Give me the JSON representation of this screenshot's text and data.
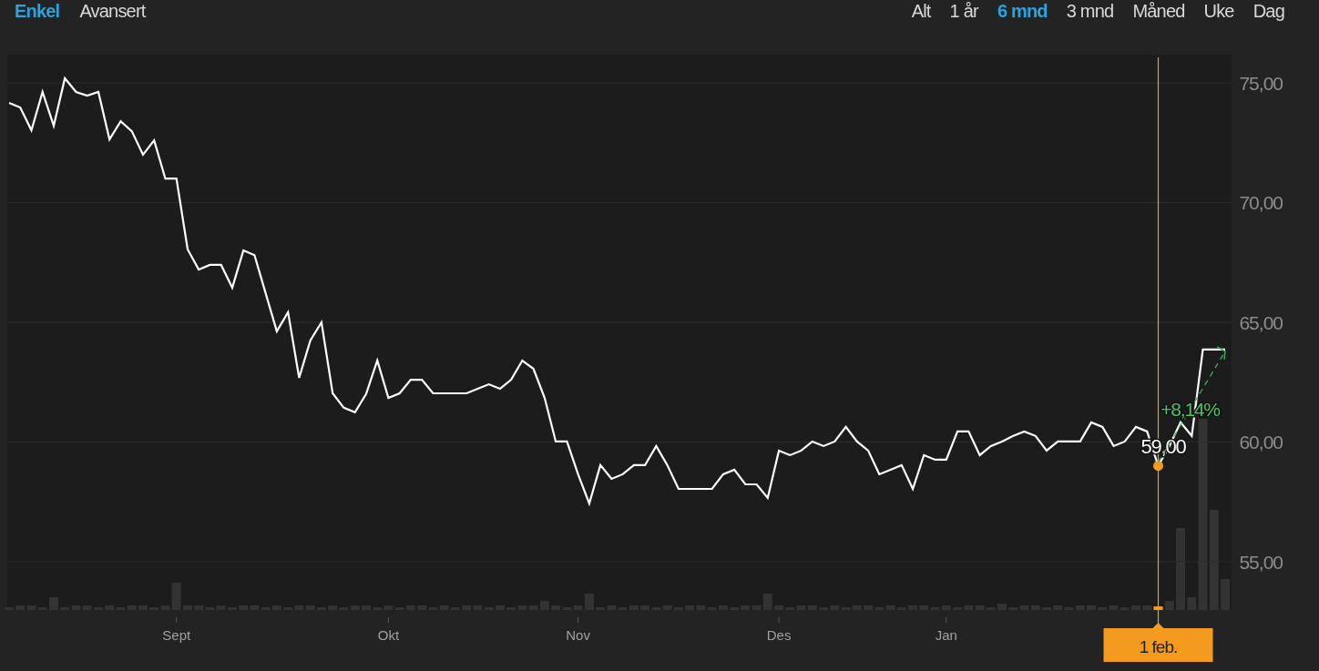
{
  "view_tabs": [
    {
      "label": "Enkel",
      "selected": true
    },
    {
      "label": "Avansert",
      "selected": false
    }
  ],
  "range_tabs": [
    {
      "label": "Alt",
      "selected": false
    },
    {
      "label": "1 år",
      "selected": false
    },
    {
      "label": "6 mnd",
      "selected": true
    },
    {
      "label": "3 mnd",
      "selected": false
    },
    {
      "label": "Måned",
      "selected": false
    },
    {
      "label": "Uke",
      "selected": false
    },
    {
      "label": "Dag",
      "selected": false
    }
  ],
  "chart": {
    "cursor": {
      "date_label": "1 feb.",
      "price_label": "59,00",
      "change_label": "+8,14%"
    },
    "chart_data": {
      "type": "line",
      "grid": true,
      "ylim": [
        52.98,
        76.18
      ],
      "categories": [
        null,
        null,
        null,
        null,
        null,
        null,
        null,
        null,
        null,
        null,
        null,
        null,
        null,
        null,
        null,
        "Sept",
        null,
        null,
        null,
        null,
        null,
        null,
        null,
        null,
        null,
        null,
        null,
        null,
        null,
        null,
        null,
        null,
        null,
        null,
        "Okt",
        null,
        null,
        null,
        null,
        null,
        null,
        null,
        null,
        null,
        null,
        null,
        null,
        null,
        null,
        null,
        null,
        "Nov",
        null,
        null,
        null,
        null,
        null,
        null,
        null,
        null,
        null,
        null,
        null,
        null,
        null,
        null,
        null,
        null,
        null,
        "Des",
        null,
        null,
        null,
        null,
        null,
        null,
        null,
        null,
        null,
        null,
        null,
        null,
        null,
        null,
        "Jan",
        null,
        null,
        null,
        null,
        null,
        null,
        null,
        null,
        null,
        null,
        null,
        null,
        null,
        null,
        null,
        null,
        null,
        null,
        null,
        null,
        null,
        null,
        null,
        null,
        null
      ],
      "yticks": [
        {
          "value": 55,
          "label": "55,00"
        },
        {
          "value": 60,
          "label": "60,00"
        },
        {
          "value": 65,
          "label": "65,00"
        },
        {
          "value": 70,
          "label": "70,00"
        },
        {
          "value": 75,
          "label": "75,00"
        }
      ],
      "series": [
        {
          "color": "#ffffff",
          "values": [
            74.16,
            73.97,
            73.02,
            74.62,
            73.21,
            75.19,
            74.62,
            74.47,
            74.62,
            72.64,
            73.4,
            72.98,
            72.0,
            72.6,
            71.0,
            71.0,
            68.04,
            67.2,
            67.4,
            67.4,
            66.44,
            68.0,
            67.8,
            66.2,
            64.62,
            65.42,
            62.68,
            64.24,
            65.0,
            62.03,
            61.43,
            61.24,
            62.0,
            63.4,
            61.84,
            62.03,
            62.6,
            62.6,
            62.03,
            62.03,
            62.03,
            62.03,
            62.22,
            62.41,
            62.22,
            62.6,
            63.4,
            63.06,
            61.84,
            60.02,
            60.02,
            58.65,
            57.43,
            59.03,
            58.46,
            58.65,
            59.03,
            59.03,
            59.83,
            59.03,
            58.04,
            58.04,
            58.04,
            58.04,
            58.65,
            58.84,
            58.23,
            58.23,
            57.66,
            59.64,
            59.45,
            59.64,
            60.02,
            59.83,
            60.02,
            60.63,
            60.02,
            59.64,
            58.65,
            58.84,
            59.03,
            58.04,
            59.45,
            59.26,
            59.26,
            60.44,
            60.44,
            59.45,
            59.83,
            60.02,
            60.25,
            60.44,
            60.25,
            59.64,
            60.02,
            60.02,
            60.02,
            60.82,
            60.63,
            59.83,
            60.02,
            60.63,
            60.44,
            59.0,
            59.83,
            60.82,
            60.25,
            63.86,
            63.86,
            63.86
          ]
        }
      ]
    }
  }
}
